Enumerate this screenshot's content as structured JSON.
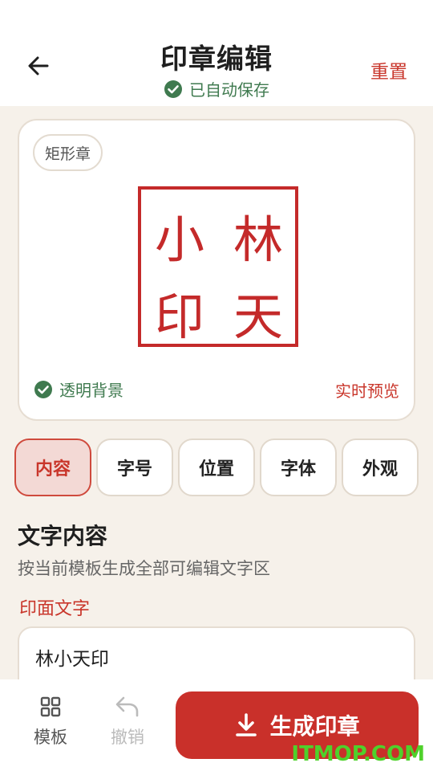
{
  "header": {
    "title": "印章编辑",
    "autosave_text": "已自动保存",
    "reset_label": "重置"
  },
  "preview": {
    "shape_label": "矩形章",
    "seal_chars": [
      "林",
      "小",
      "天",
      "印"
    ],
    "transparent_bg_label": "透明背景",
    "realtime_label": "实时预览"
  },
  "tabs": [
    {
      "label": "内容",
      "active": true
    },
    {
      "label": "字号",
      "active": false
    },
    {
      "label": "位置",
      "active": false
    },
    {
      "label": "字体",
      "active": false
    },
    {
      "label": "外观",
      "active": false
    }
  ],
  "section": {
    "title": "文字内容",
    "description": "按当前模板生成全部可编辑文字区",
    "field_label": "印面文字",
    "field_value": "林小天印"
  },
  "bottom": {
    "templates_label": "模板",
    "undo_label": "撤销",
    "generate_label": "生成印章"
  },
  "watermark": "ITMOP.COM",
  "colors": {
    "accent_red": "#c9302a",
    "success_green": "#3f7a4f",
    "background": "#f6f1ea"
  }
}
